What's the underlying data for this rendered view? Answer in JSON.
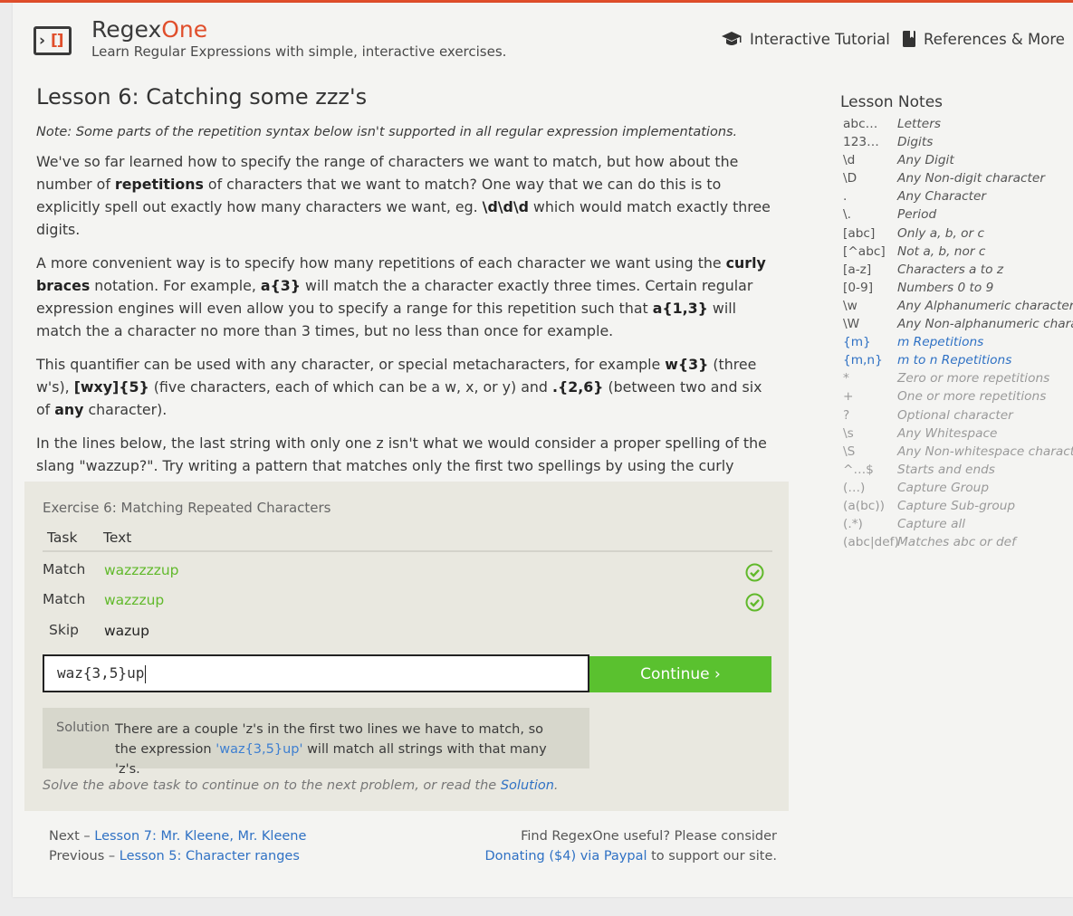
{
  "header": {
    "brand_main": "Regex",
    "brand_accent": "One",
    "tagline": "Learn Regular Expressions with simple, interactive exercises.",
    "nav": [
      {
        "label": "Interactive Tutorial",
        "icon": "graduation-cap-icon"
      },
      {
        "label": "References & More",
        "icon": "book-icon"
      }
    ]
  },
  "lesson": {
    "title": "Lesson 6: Catching some zzz's",
    "note": "Note: Some parts of the repetition syntax below isn't supported in all regular expression implementations.",
    "p1": {
      "a": "We've so far learned how to specify the range of characters we want to match, but how about the number of ",
      "b": "repetitions",
      "c": " of characters that we want to match? One way that we can do this is to explicitly spell out exactly how many characters we want, eg. ",
      "d": "\\d\\d\\d",
      "e": " which would match exactly three digits."
    },
    "p2": {
      "a": "A more convenient way is to specify how many repetitions of each character we want using the ",
      "b": "curly braces",
      "c": " notation. For example, ",
      "d": "a{3}",
      "e": " will match the a character exactly three times. Certain regular expression engines will even allow you to specify a range for this repetition such that ",
      "f": "a{1,3}",
      "g": " will match the a character no more than 3 times, but no less than once for example."
    },
    "p3": {
      "a": "This quantifier can be used with any character, or special metacharacters, for example ",
      "b": "w{3}",
      "c": " (three w's), ",
      "d": "[wxy]{5}",
      "e": " (five characters, each of which can be a w, x, or y) and ",
      "f": ".{2,6}",
      "g": " (between two and six of ",
      "h": "any",
      "i": " character)."
    },
    "p4": "In the lines below, the last string with only one z isn't what we would consider a proper spelling of the slang \"wazzup?\". Try writing a pattern that matches only the first two spellings by using the curly brace notation above."
  },
  "exercise": {
    "title": "Exercise 6: Matching Repeated Characters",
    "col_task": "Task",
    "col_text": "Text",
    "rows": [
      {
        "task": "Match",
        "text": "wazzzzzup",
        "status": "success"
      },
      {
        "task": "Match",
        "text": "wazzzup",
        "status": "success"
      },
      {
        "task": "Skip",
        "text": "wazup",
        "status": "none"
      }
    ],
    "input_value": "waz{3,5}up",
    "continue_label": "Continue ›",
    "solution_label": "Solution",
    "solution_a": "There are a couple 'z's in the first two lines we have to match, so the expression ",
    "solution_code": "'waz{3,5}up'",
    "solution_b": " will match all strings with that many 'z's.",
    "footer_a": "Solve the above task to continue on to the next problem, or read the ",
    "footer_link": "Solution",
    "footer_b": "."
  },
  "footer": {
    "next_prefix": "Next – ",
    "next_link": "Lesson 7: Mr. Kleene, Mr. Kleene",
    "prev_prefix": "Previous – ",
    "prev_link": "Lesson 5: Character ranges",
    "support_a": "Find RegexOne useful? Please consider",
    "support_link": "Donating ($4) via Paypal",
    "support_b": " to support our site."
  },
  "notes": {
    "title": "Lesson Notes",
    "items": [
      {
        "k": "abc…",
        "d": "Letters",
        "state": "normal"
      },
      {
        "k": "123…",
        "d": "Digits",
        "state": "normal"
      },
      {
        "k": "\\d",
        "d": "Any Digit",
        "state": "normal"
      },
      {
        "k": "\\D",
        "d": "Any Non-digit character",
        "state": "normal"
      },
      {
        "k": ".",
        "d": "Any Character",
        "state": "normal"
      },
      {
        "k": "\\.",
        "d": "Period",
        "state": "normal"
      },
      {
        "k": "[abc]",
        "d": "Only a, b, or c",
        "state": "normal"
      },
      {
        "k": "[^abc]",
        "d": "Not a, b, nor c",
        "state": "normal"
      },
      {
        "k": "[a-z]",
        "d": "Characters a to z",
        "state": "normal"
      },
      {
        "k": "[0-9]",
        "d": "Numbers 0 to 9",
        "state": "normal"
      },
      {
        "k": "\\w",
        "d": "Any Alphanumeric character",
        "state": "normal"
      },
      {
        "k": "\\W",
        "d": "Any Non-alphanumeric character",
        "state": "normal"
      },
      {
        "k": "{m}",
        "d": "m Repetitions",
        "state": "current"
      },
      {
        "k": "{m,n}",
        "d": "m to n Repetitions",
        "state": "current"
      },
      {
        "k": "*",
        "d": "Zero or more repetitions",
        "state": "future"
      },
      {
        "k": "+",
        "d": "One or more repetitions",
        "state": "future"
      },
      {
        "k": "?",
        "d": "Optional character",
        "state": "future"
      },
      {
        "k": "\\s",
        "d": "Any Whitespace",
        "state": "future"
      },
      {
        "k": "\\S",
        "d": "Any Non-whitespace character",
        "state": "future"
      },
      {
        "k": "^…$",
        "d": "Starts and ends",
        "state": "future"
      },
      {
        "k": "(…)",
        "d": "Capture Group",
        "state": "future"
      },
      {
        "k": "(a(bc))",
        "d": "Capture Sub-group",
        "state": "future"
      },
      {
        "k": "(.*)",
        "d": "Capture all",
        "state": "future"
      },
      {
        "k": "(abc|def)",
        "d": "Matches abc or def",
        "state": "future"
      }
    ]
  },
  "colors": {
    "brand_accent": "#e04e2b",
    "success": "#61b92b",
    "continue_button": "#5ac12f",
    "link": "#2f71c4"
  }
}
